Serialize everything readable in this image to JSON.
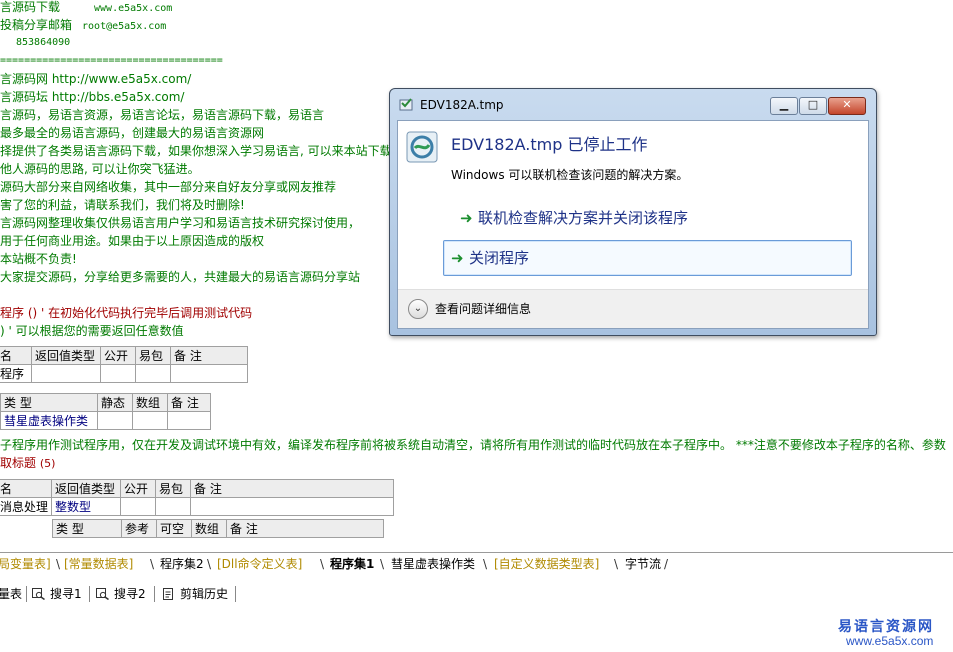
{
  "editor": {
    "header": [
      {
        "text": "言源码下载",
        "tail": "www.e5a5x.com"
      },
      {
        "text": "投稿分享邮箱",
        "tail": "root@e5a5x.com"
      },
      {
        "text": "",
        "tail": "853864090"
      }
    ],
    "divider": "=====================================",
    "comments": [
      "言源码网 http://www.e5a5x.com/",
      "言源码坛 http://bbs.e5a5x.com/",
      "言源码，易语言资源，易语言论坛，易语言源码下载，易语言",
      "最多最全的易语言源码，创建最大的易语言资源网",
      "择提供了各类易语言源码下载，如果你想深入学习易语言, 可以来本站下载相",
      "他人源码的思路, 可以让你突飞猛进。",
      "源码大部分来自网络收集，其中一部分来自好友分享或网友推荐",
      "害了您的利益，请联系我们，我们将及时删除!",
      "言源码网整理收集仅供易语言用户学习和易语言技术研究探讨使用，",
      "用于任何商业用途。如果由于以上原因造成的版权",
      "本站概不负责!",
      "大家提交源码，分享给更多需要的人，共建最大的易语言源码分享站"
    ],
    "proc_line1": "程序 ()  ' 在初始化代码执行完毕后调用测试代码",
    "proc_line2": ")  ' 可以根据您的需要返回任意数值",
    "table1": {
      "headers": [
        "名",
        "返回值类型",
        "公开",
        "易包",
        "备 注"
      ],
      "row": [
        "程序",
        "",
        "",
        "",
        ""
      ]
    },
    "table2": {
      "headers": [
        "类 型",
        "静态",
        "数组",
        "备 注"
      ],
      "row": [
        "彗星虚表操作类",
        "",
        "",
        ""
      ]
    },
    "long_comment": "子程序用作测试程序用，仅在开发及调试环境中有效，编译发布程序前将被系统自动清空，请将所有用作测试的临时代码放在本子程序中。 ***注意不要修改本子程序的名称、参数",
    "section_title": "取标题",
    "section_count": "(5)",
    "table3": {
      "headers": [
        "名",
        "返回值类型",
        "公开",
        "易包",
        "备 注"
      ],
      "row": [
        "消息处理",
        "整数型",
        "",
        "",
        ""
      ],
      "sub_headers": [
        "类 型",
        "参考",
        "可空",
        "数组",
        "备 注"
      ]
    }
  },
  "tabs": [
    {
      "label": "局变量表]",
      "style": "y"
    },
    {
      "label": "[常量数据表]",
      "style": "y"
    },
    {
      "label": "程序集2",
      "style": "n"
    },
    {
      "label": "[Dll命令定义表]",
      "style": "y"
    },
    {
      "label": "程序集1",
      "style": "act"
    },
    {
      "label": "彗星虚表操作类",
      "style": "n"
    },
    {
      "label": "[自定义数据类型表]",
      "style": "y"
    },
    {
      "label": "字节流",
      "style": "n"
    }
  ],
  "toolbar": {
    "item0": "量表",
    "item1": "搜寻1",
    "item2": "搜寻2",
    "item3": "剪辑历史"
  },
  "watermark": {
    "line1": "易语言资源网",
    "line2": "www.e5a5x.com"
  },
  "dialog": {
    "title": "EDV182A.tmp",
    "heading": "EDV182A.tmp 已停止工作",
    "message": "Windows 可以联机检查该问题的解决方案。",
    "option1": "联机检查解决方案并关闭该程序",
    "option2": "关闭程序",
    "details": "查看问题详细信息",
    "minimize_glyph": "▁",
    "maximize_glyph": "□",
    "close_glyph": "✕",
    "arrow_glyph": "➜",
    "chevron_glyph": "⌄"
  }
}
